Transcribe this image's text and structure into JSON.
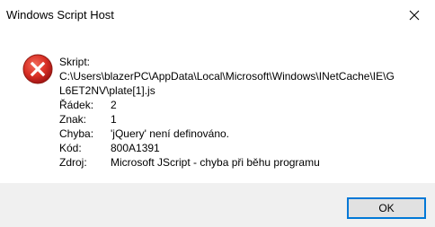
{
  "window": {
    "title": "Windows Script Host",
    "close_icon": "close-icon"
  },
  "message": {
    "icon": "error-icon",
    "script_label": "Skript:",
    "script_path_line1": "C:\\Users\\blazerPC\\AppData\\Local\\Microsoft\\Windows\\INetCache\\IE\\G",
    "script_path_line2": "L6ET2NV\\plate[1].js",
    "fields": [
      {
        "label": "Řádek:",
        "value": "2"
      },
      {
        "label": "Znak:",
        "value": "1"
      },
      {
        "label": "Chyba:",
        "value": "'jQuery' není definováno."
      },
      {
        "label": "Kód:",
        "value": "800A1391"
      },
      {
        "label": "Zdroj:",
        "value": "Microsoft JScript - chyba při běhu programu"
      }
    ]
  },
  "buttons": {
    "ok_label": "OK"
  },
  "colors": {
    "error_red": "#d93025",
    "button_border": "#0078d7",
    "footer_bg": "#f0f0f0"
  }
}
